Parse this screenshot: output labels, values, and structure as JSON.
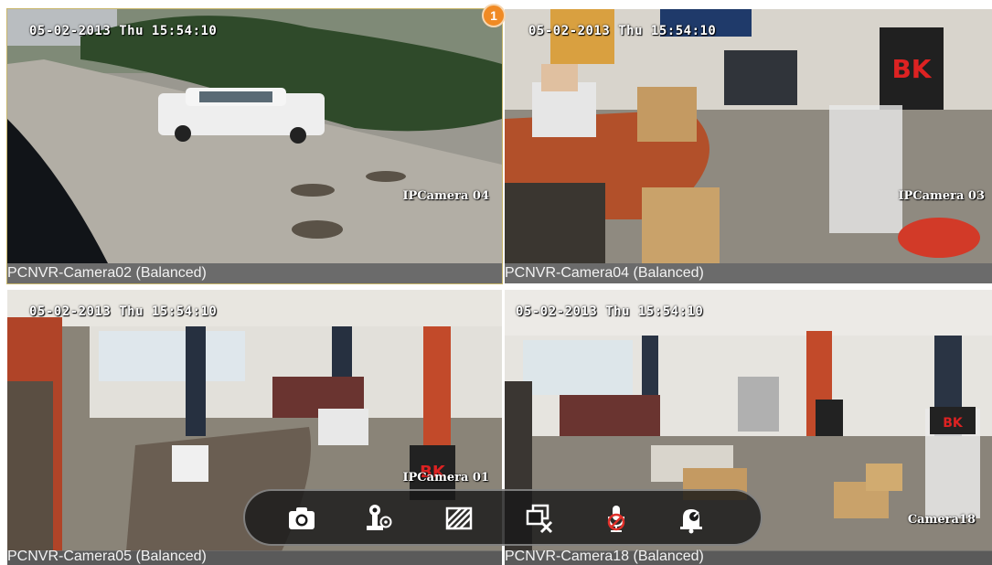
{
  "cameras": [
    {
      "timestamp": "05-02-2013 Thu 15:54:10",
      "osd_name": "IPCamera 04",
      "label": "PCNVR-Camera02 (Balanced)",
      "selected": true
    },
    {
      "timestamp": "05-02-2013 Thu 15:54:10",
      "osd_name": "IPCamera 03",
      "label": "PCNVR-Camera04 (Balanced)",
      "selected": false
    },
    {
      "timestamp": "05-02-2013 Thu 15:54:10",
      "osd_name": "IPCamera 01",
      "label": "PCNVR-Camera05 (Balanced)",
      "selected": false
    },
    {
      "timestamp": "05-02-2013 Thu 15:54:10",
      "osd_name": "Camera18",
      "label": "PCNVR-Camera18 (Balanced)",
      "selected": false
    }
  ],
  "badge": {
    "count": "1",
    "color": "#f08a24"
  },
  "toolbar": {
    "buttons": [
      {
        "icon": "camera-snapshot-icon"
      },
      {
        "icon": "ptz-control-icon"
      },
      {
        "icon": "aspect-fill-icon"
      },
      {
        "icon": "close-windows-icon"
      },
      {
        "icon": "microphone-muted-icon"
      },
      {
        "icon": "alarm-bell-icon"
      }
    ],
    "icon_color": "#ffffff",
    "accent_color": "#e0302a"
  }
}
